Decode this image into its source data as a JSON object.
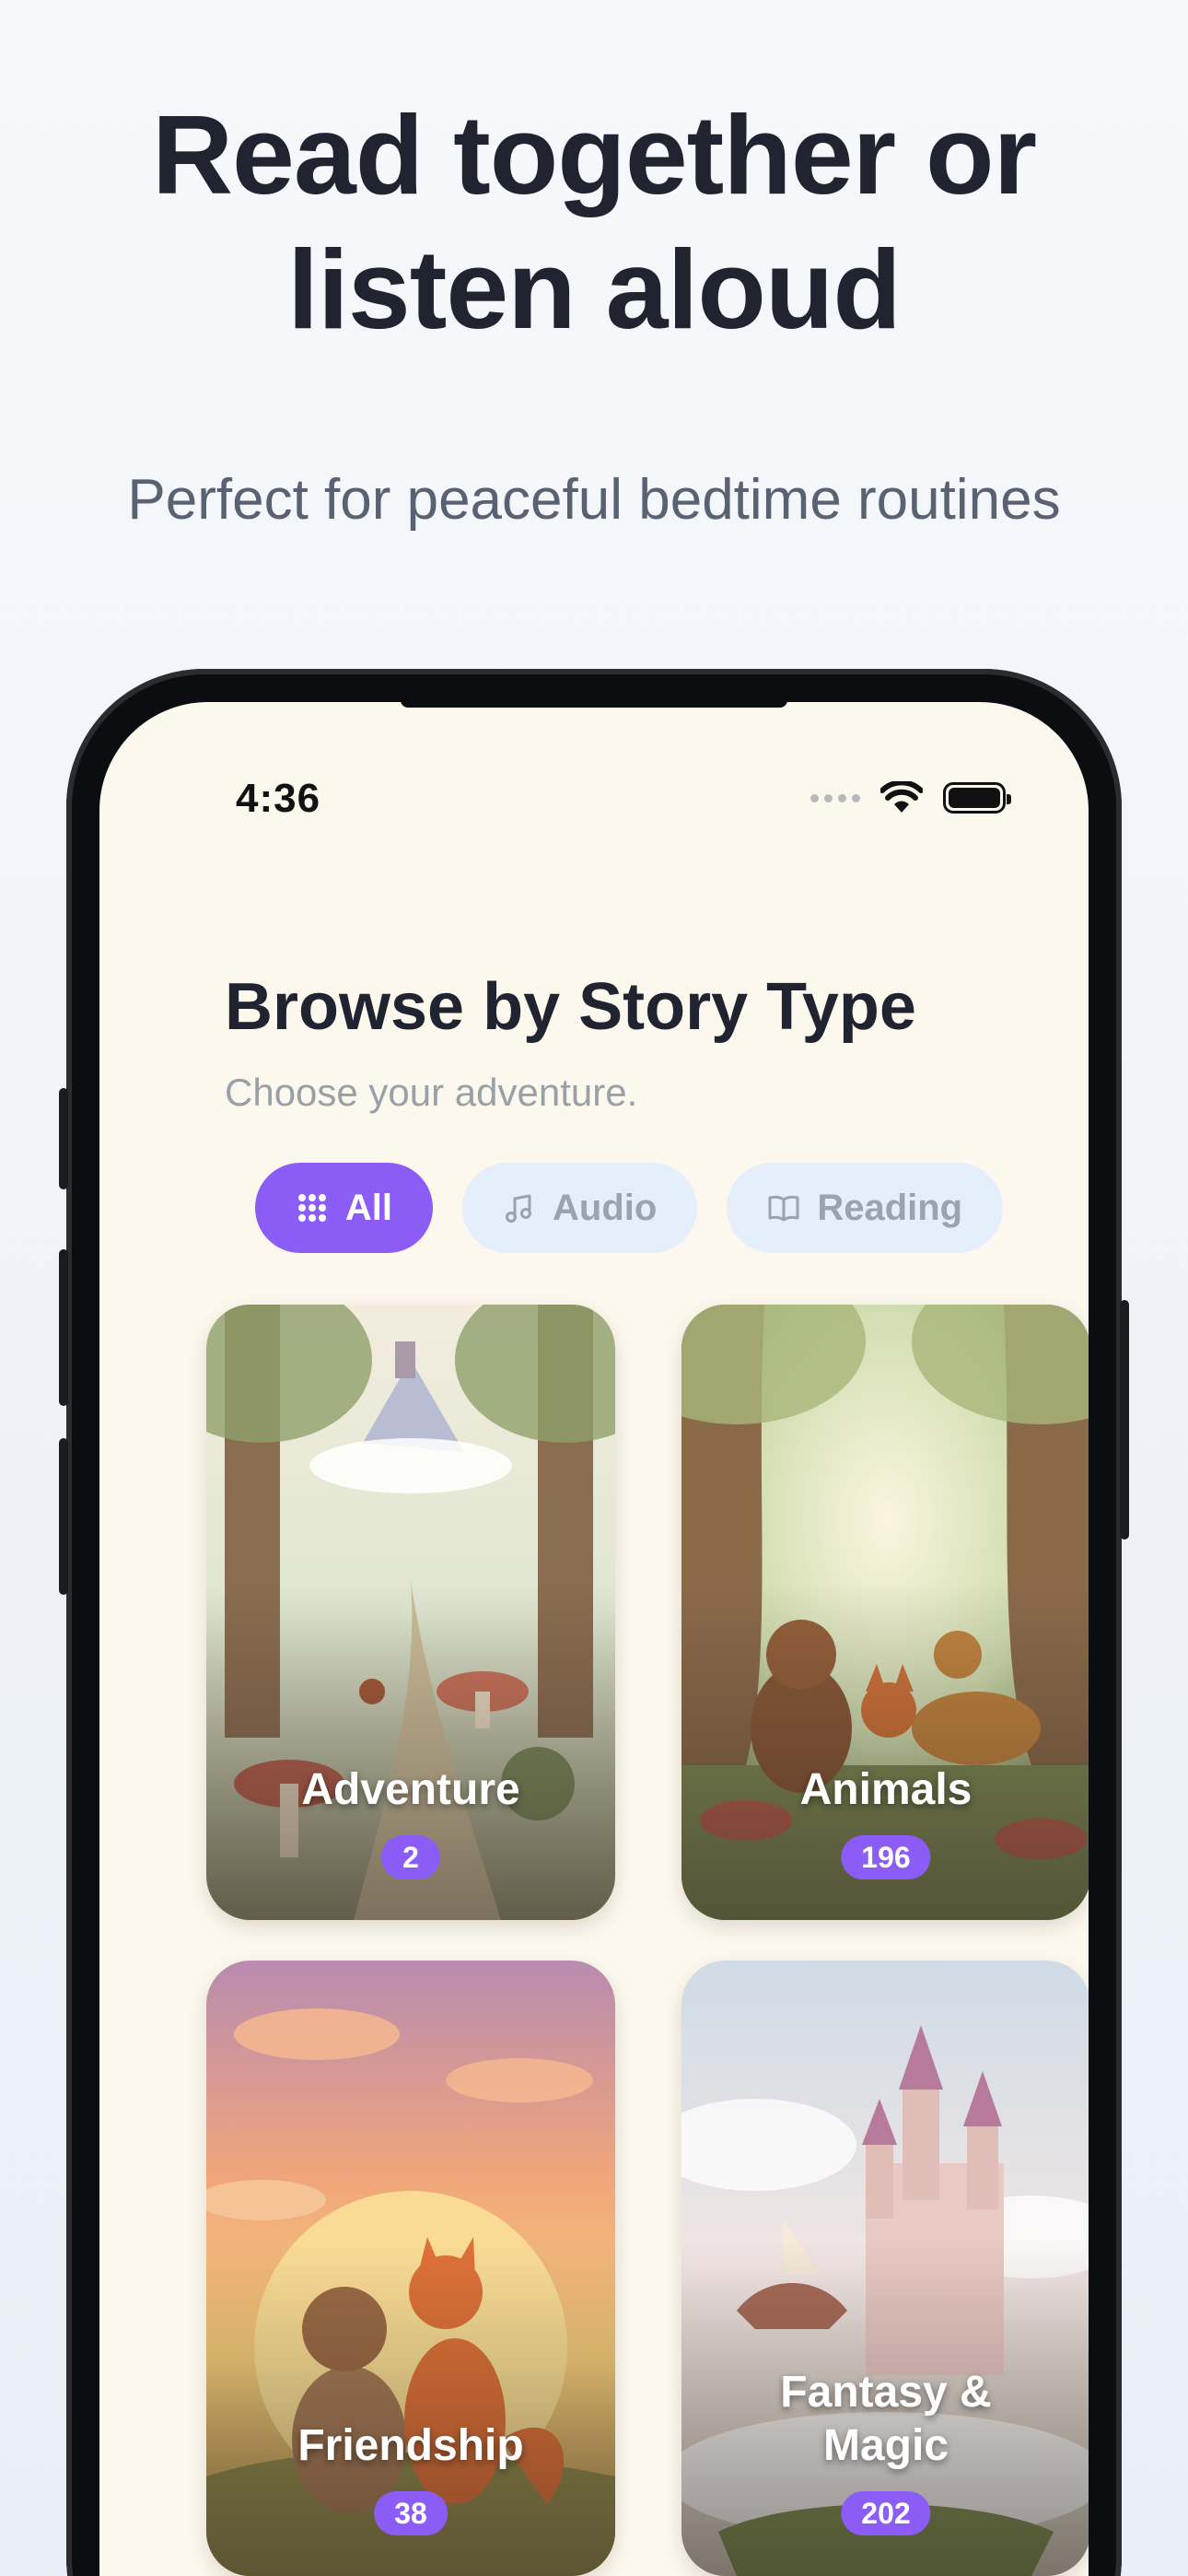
{
  "headline": "Read together or listen aloud",
  "subheadline": "Perfect for peaceful bedtime routines",
  "status_bar": {
    "time": "4:36"
  },
  "screen": {
    "title": "Browse by Story Type",
    "subtitle": "Choose your adventure.",
    "filters": [
      {
        "label": "All",
        "icon": "grid-icon",
        "active": true
      },
      {
        "label": "Audio",
        "icon": "music-note-icon",
        "active": false
      },
      {
        "label": "Reading",
        "icon": "book-icon",
        "active": false
      }
    ],
    "categories": [
      {
        "name": "Adventure",
        "count": "2"
      },
      {
        "name": "Animals",
        "count": "196"
      },
      {
        "name": "Friendship",
        "count": "38"
      },
      {
        "name": "Fantasy & Magic",
        "count": "202"
      }
    ]
  },
  "colors": {
    "accent": "#8b5cf6",
    "screen_bg": "#fdf8ee",
    "chip_inactive": "#e4effb"
  }
}
